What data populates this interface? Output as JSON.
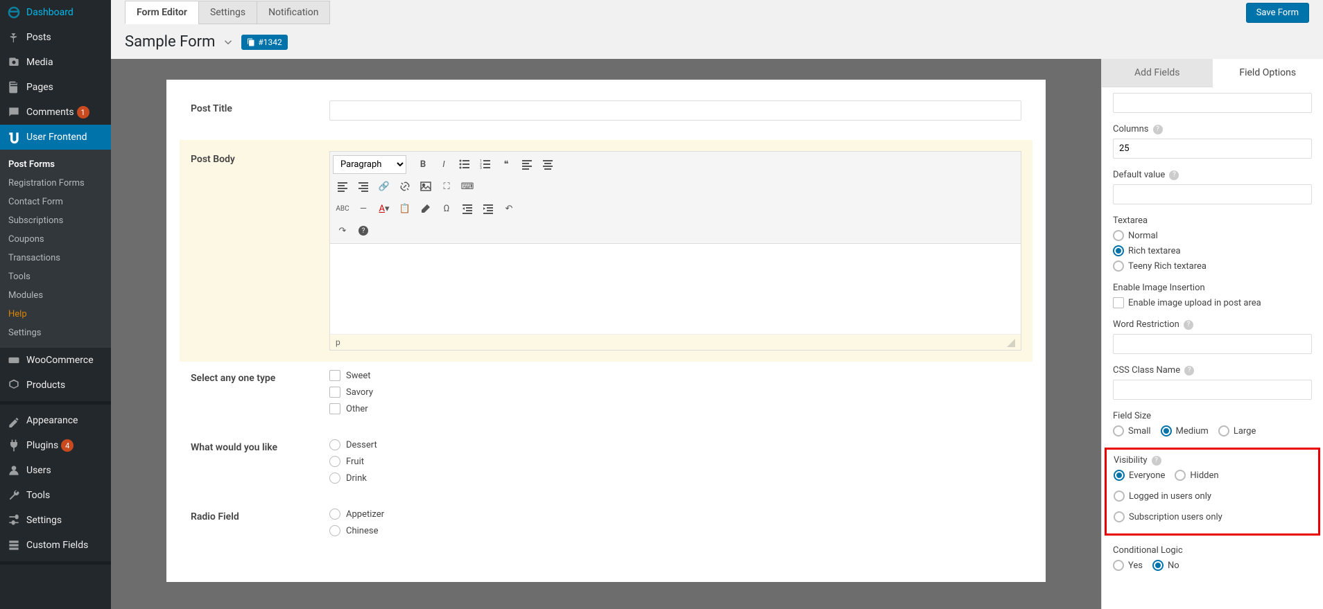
{
  "sidebar": {
    "items": [
      {
        "icon": "dashboard",
        "label": "Dashboard"
      },
      {
        "icon": "pin",
        "label": "Posts"
      },
      {
        "icon": "media",
        "label": "Media"
      },
      {
        "icon": "page",
        "label": "Pages"
      },
      {
        "icon": "comment",
        "label": "Comments",
        "badge": "1"
      },
      {
        "icon": "uf",
        "label": "User Frontend",
        "active": true
      },
      {
        "icon": "woo",
        "label": "WooCommerce"
      },
      {
        "icon": "product",
        "label": "Products"
      },
      {
        "icon": "appearance",
        "label": "Appearance"
      },
      {
        "icon": "plugin",
        "label": "Plugins",
        "badge": "4"
      },
      {
        "icon": "users",
        "label": "Users"
      },
      {
        "icon": "tools",
        "label": "Tools"
      },
      {
        "icon": "settings",
        "label": "Settings"
      },
      {
        "icon": "cf",
        "label": "Custom Fields"
      }
    ],
    "sub": [
      {
        "label": "Post Forms",
        "sel": true
      },
      {
        "label": "Registration Forms"
      },
      {
        "label": "Contact Form"
      },
      {
        "label": "Subscriptions"
      },
      {
        "label": "Coupons"
      },
      {
        "label": "Transactions"
      },
      {
        "label": "Tools"
      },
      {
        "label": "Modules"
      },
      {
        "label": "Help",
        "help": true
      },
      {
        "label": "Settings"
      }
    ]
  },
  "topbar": {
    "tabs": [
      {
        "label": "Form Editor",
        "active": true
      },
      {
        "label": "Settings"
      },
      {
        "label": "Notification"
      }
    ],
    "save": "Save Form"
  },
  "title": {
    "name": "Sample Form",
    "id": "#1342"
  },
  "form": {
    "fields": [
      {
        "label": "Post Title",
        "type": "text"
      },
      {
        "label": "Post Body",
        "type": "rte",
        "selected": true
      },
      {
        "label": "Select any one type",
        "type": "checkboxes",
        "options": [
          "Sweet",
          "Savory",
          "Other"
        ]
      },
      {
        "label": "What would you like",
        "type": "radios",
        "options": [
          "Dessert",
          "Fruit",
          "Drink"
        ]
      },
      {
        "label": "Radio Field",
        "type": "radios",
        "options": [
          "Appetizer",
          "Chinese"
        ]
      }
    ],
    "rte": {
      "format": "Paragraph",
      "path": "p"
    }
  },
  "panel": {
    "tabs": [
      {
        "label": "Add Fields"
      },
      {
        "label": "Field Options",
        "active": true
      }
    ],
    "columns": {
      "label": "Columns",
      "value": "25"
    },
    "default_value": {
      "label": "Default value"
    },
    "textarea": {
      "label": "Textarea",
      "options": [
        "Normal",
        "Rich textarea",
        "Teeny Rich textarea"
      ],
      "selected": "Rich textarea"
    },
    "image_insert": {
      "label": "Enable Image Insertion",
      "check": "Enable image upload in post area"
    },
    "word_restrict": {
      "label": "Word Restriction"
    },
    "css": {
      "label": "CSS Class Name"
    },
    "field_size": {
      "label": "Field Size",
      "options": [
        "Small",
        "Medium",
        "Large"
      ],
      "selected": "Medium"
    },
    "visibility": {
      "label": "Visibility",
      "options": [
        "Everyone",
        "Hidden",
        "Logged in users only",
        "Subscription users only"
      ],
      "selected": "Everyone"
    },
    "cond": {
      "label": "Conditional Logic",
      "options": [
        "Yes",
        "No"
      ],
      "selected": "No"
    }
  }
}
